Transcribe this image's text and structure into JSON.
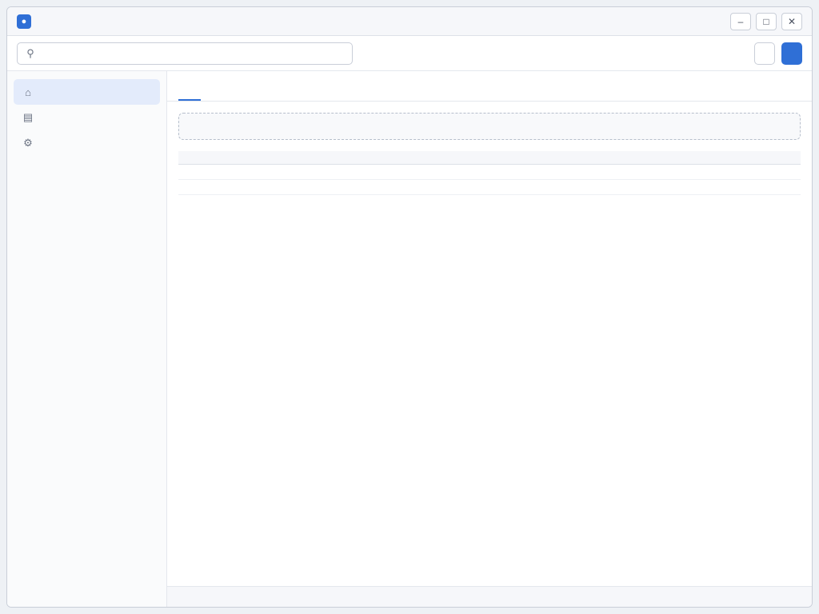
{
  "window": {
    "title": ""
  },
  "toolbar": {
    "search_placeholder": "",
    "search_value": "",
    "new_label": "",
    "refresh_label": ""
  },
  "sidebar": {
    "items": [
      {
        "label": "",
        "icon": "home-icon"
      },
      {
        "label": "",
        "icon": "folder-icon"
      },
      {
        "label": "",
        "icon": "gear-icon"
      }
    ]
  },
  "tabs": [
    {
      "label": ""
    },
    {
      "label": ""
    }
  ],
  "notice": {
    "title": "",
    "text": ""
  },
  "table": {
    "headers": [
      "",
      "",
      ""
    ],
    "rows": [
      [
        "",
        "",
        ""
      ],
      [
        "",
        "",
        ""
      ]
    ]
  },
  "status": {
    "left": "",
    "right": ""
  },
  "colors": {
    "accent": "#2f6fd6",
    "icon_bg": "#2f6fd6"
  }
}
